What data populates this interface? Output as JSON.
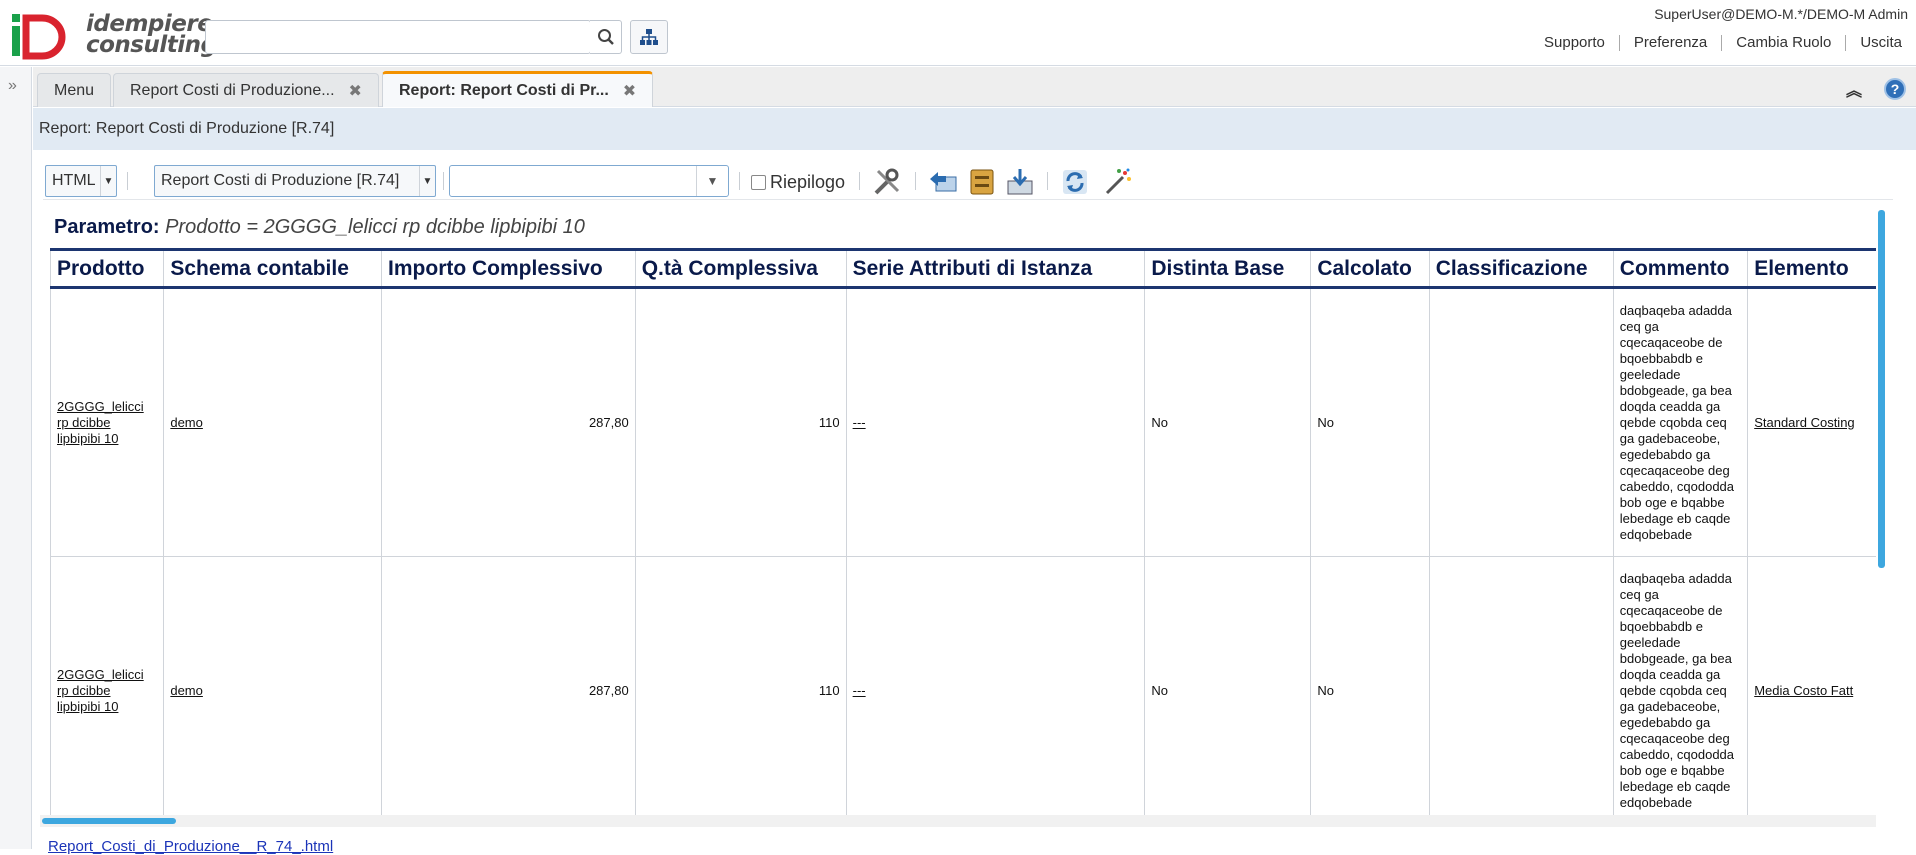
{
  "header": {
    "logo_line1": "idempiere",
    "logo_line2": "consulting",
    "search": {
      "value": "",
      "placeholder": ""
    },
    "user": "SuperUser@DEMO-M.*/DEMO-M Admin",
    "links": [
      "Supporto",
      "Preferenza",
      "Cambia Ruolo",
      "Uscita"
    ]
  },
  "tabs": [
    {
      "label": "Menu",
      "closable": false
    },
    {
      "label": "Report Costi di Produzione...",
      "closable": true
    },
    {
      "label": "Report: Report Costi di Pr...",
      "closable": true,
      "active": true
    }
  ],
  "title_strip": "Report: Report Costi di Produzione [R.74]",
  "toolbar": {
    "format": "HTML",
    "print_format": "Report Costi di Produzione [R.74]",
    "combo_value": "",
    "summary_label": "Riepilogo",
    "summary_checked": false,
    "icons": [
      "customize-icon",
      "drill-back-icon",
      "archive-icon",
      "export-icon",
      "refresh-icon",
      "wizard-icon"
    ]
  },
  "report": {
    "parameter_label": "Parametro:",
    "parameter_value": "Prodotto = 2GGGG_lelicci rp dcibbe lipbipibi 10",
    "columns": [
      "Prodotto",
      "Schema contabile",
      "Importo Complessivo",
      "Q.tà Complessiva",
      "Serie Attributi di Istanza",
      "Distinta Base",
      "Calcolato",
      "Classificazione",
      "Commento",
      "Elemento"
    ],
    "rows": [
      {
        "prodotto": "2GGGG_lelicci rp dcibbe lipbipibi 10",
        "schema": "demo",
        "importo": "287,80",
        "qta": "110",
        "serie": "---",
        "distinta": "No",
        "calcolato": "No",
        "classificazione": "",
        "commento": "daqbaqeba adadda ceq ga cqecaqaceobe de bqoebbabdb e geeledade bdobgeade, ga bea doqda ceadda ga qebde cqobda ceq ga gadebaceobe, egedebabdo ga cqecaqaceobe deg cabeddo, cqododda bob oge e bqabbe lebedage eb caqde edqobebade",
        "elemento": "Standard Costing"
      },
      {
        "prodotto": "2GGGG_lelicci rp dcibbe lipbipibi 10",
        "schema": "demo",
        "importo": "287,80",
        "qta": "110",
        "serie": "---",
        "distinta": "No",
        "calcolato": "No",
        "classificazione": "",
        "commento": "daqbaqeba adadda ceq ga cqecaqaceobe de bqoebbabdb e geeledade bdobgeade, ga bea doqda ceadda ga qebde cqobda ceq ga gadebaceobe, egedebabdo ga cqecaqaceobe deg cabeddo, cqododda bob oge e bqabbe lebedage eb caqde edqobebade",
        "elemento": "Media Costo Fatt"
      }
    ]
  },
  "file_link": "Report_Costi_di_Produzione__R_74_.html",
  "colors": {
    "accent": "#f39200",
    "header_blue": "#1c3570",
    "title_strip": "#e1eaf3",
    "scroll": "#3da7df"
  }
}
